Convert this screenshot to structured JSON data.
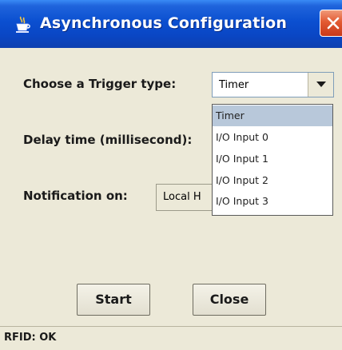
{
  "window": {
    "title": "Asynchronous Configuration"
  },
  "form": {
    "trigger_label": "Choose a Trigger type:",
    "trigger_selected": "Timer",
    "delay_label": "Delay time (millisecond):",
    "notification_label": "Notification on:",
    "notification_value": "Local H"
  },
  "dropdown": {
    "options": [
      "Timer",
      "I/O Input 0",
      "I/O Input 1",
      "I/O Input 2",
      "I/O Input 3"
    ],
    "highlighted_index": 0
  },
  "buttons": {
    "start_label": "Start",
    "close_label": "Close"
  },
  "status": {
    "text": "RFID: OK"
  },
  "colors": {
    "titlebar": "#0b4fd0",
    "background": "#ece9d8",
    "close_button": "#e25a32",
    "highlight": "#b8c8da"
  },
  "icons": {
    "window_icon": "java-cup-icon",
    "close_icon": "close-icon",
    "dropdown_arrow": "triangle-down-icon"
  }
}
